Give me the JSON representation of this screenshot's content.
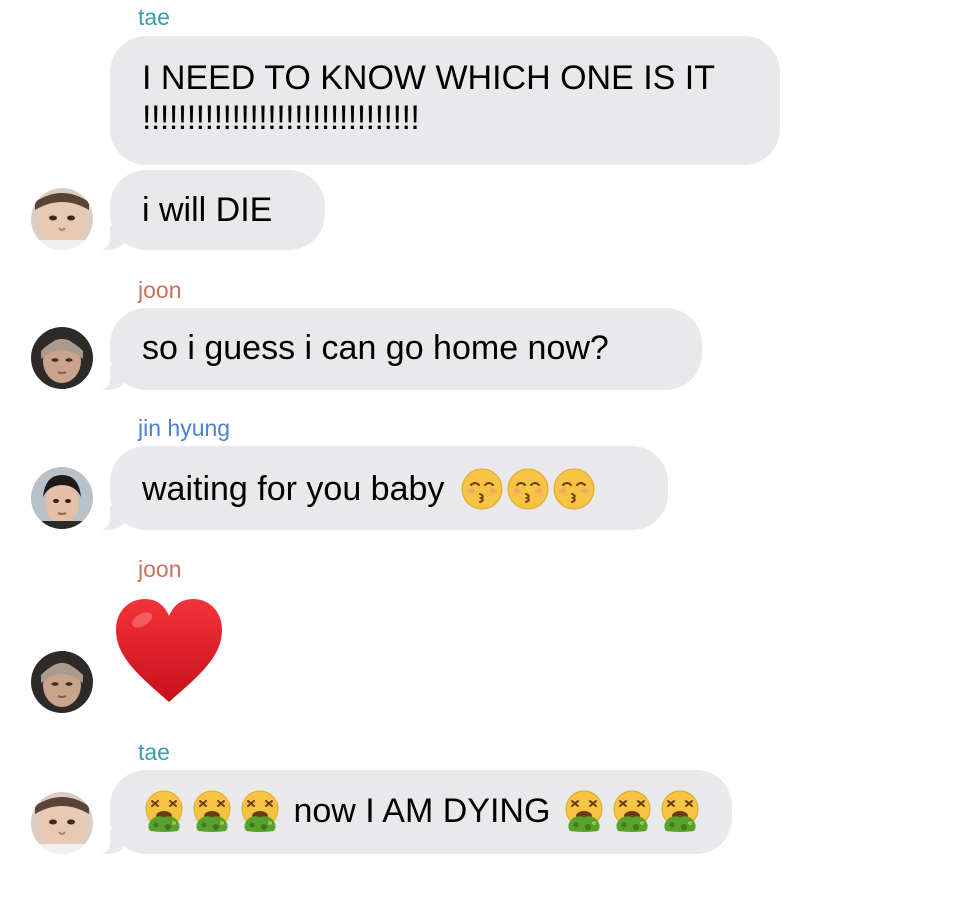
{
  "messages": [
    {
      "sender": "tae",
      "sender_color": "#3a9ea5",
      "lines": [
        "I NEED TO KNOW WHICH ONE IS IT",
        "!!!!!!!!!!!!!!!!!!!!!!!!!!!!!!!"
      ]
    },
    {
      "text": "i will DIE"
    },
    {
      "sender": "joon",
      "sender_color": "#c9705e",
      "text": "so i guess i can go home now?"
    },
    {
      "sender": "jin hyung",
      "sender_color": "#4a7fd4",
      "text": "waiting for you baby",
      "trailing_emojis": [
        "kissing-closed-eyes",
        "kissing-closed-eyes",
        "kissing-closed-eyes"
      ]
    },
    {
      "sender": "joon",
      "sender_color": "#c9705e",
      "emoji": "red-heart"
    },
    {
      "sender": "tae",
      "sender_color": "#3a9ea5",
      "text": "now I AM DYING",
      "leading_emojis": [
        "vomiting-face",
        "vomiting-face",
        "vomiting-face"
      ],
      "trailing_emojis": [
        "vomiting-face",
        "vomiting-face",
        "vomiting-face"
      ]
    }
  ],
  "colors": {
    "bubble_bg": "#e9e9eb",
    "tae": "#3a9ea5",
    "joon": "#c9705e",
    "jin": "#4a7fd4"
  }
}
